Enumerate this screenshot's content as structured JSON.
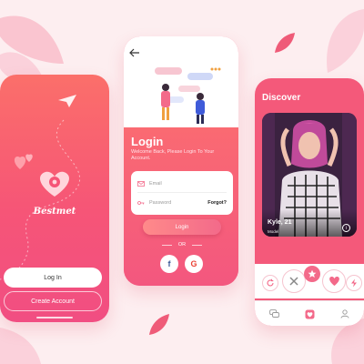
{
  "colors": {
    "accent": "#f65577",
    "bg": "#fdeef0"
  },
  "splash": {
    "brand": "Bestmet",
    "login_label": "Log In",
    "create_label": "Create Account"
  },
  "login": {
    "title": "Login",
    "subtitle": "Welcome Back, Please Login To Your Account.",
    "email_placeholder": "Email",
    "password_placeholder": "Password",
    "forgot_label": "Forgot?",
    "login_button": "Login",
    "or_label": "OR",
    "facebook_label": "f",
    "google_label": "G"
  },
  "discover": {
    "title": "Discover",
    "profile": {
      "name": "Kyle, 21",
      "role": "Model"
    },
    "info_label": "i",
    "tabs": [
      "chat-icon",
      "match-icon",
      "profile-icon"
    ]
  }
}
